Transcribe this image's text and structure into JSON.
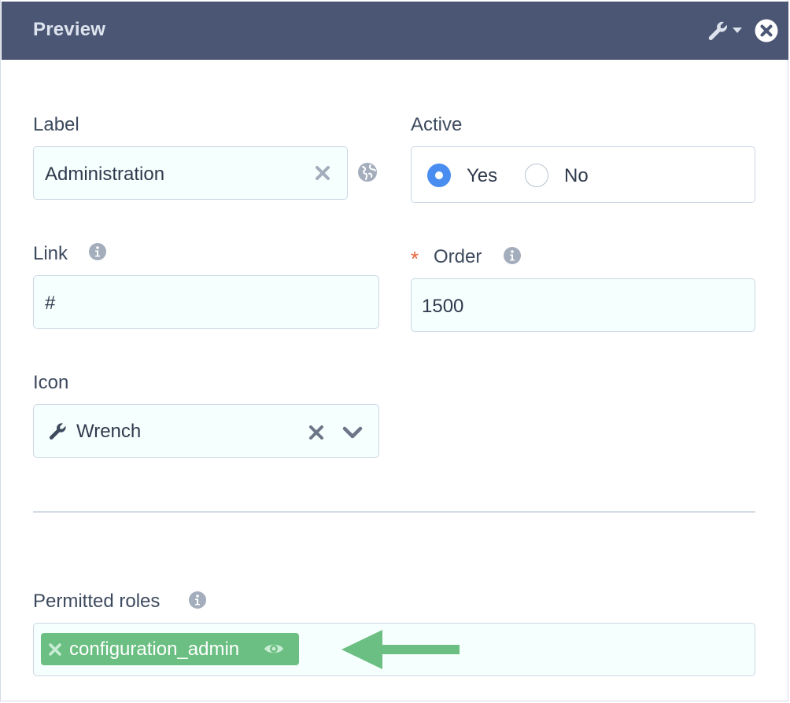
{
  "window": {
    "title": "Preview"
  },
  "form": {
    "label": {
      "caption": "Label",
      "value": "Administration"
    },
    "active": {
      "caption": "Active",
      "options": [
        "Yes",
        "No"
      ],
      "selected": "Yes"
    },
    "link": {
      "caption": "Link",
      "value": "#"
    },
    "order": {
      "caption": "Order",
      "required_mark": "*",
      "value": "1500"
    },
    "icon": {
      "caption": "Icon",
      "value": "Wrench"
    },
    "roles": {
      "caption": "Permitted roles",
      "tags": [
        "configuration_admin"
      ]
    }
  },
  "icons": {
    "header_tools": "wrench-dropdown-icon",
    "header_close": "close-circle-icon",
    "clear": "x-icon",
    "translate": "globe-icon",
    "info": "info-circle-icon",
    "select_caret": "chevron-down-icon",
    "tag_visibility": "eye-icon",
    "annotation": "arrow-left-icon"
  },
  "colors": {
    "header_bg": "#4a5673",
    "field_bg": "#f5fffd",
    "radio_active": "#4a8df0",
    "required": "#e8633a",
    "tag_bg": "#6bbf82",
    "arrow": "#6bbf82"
  }
}
